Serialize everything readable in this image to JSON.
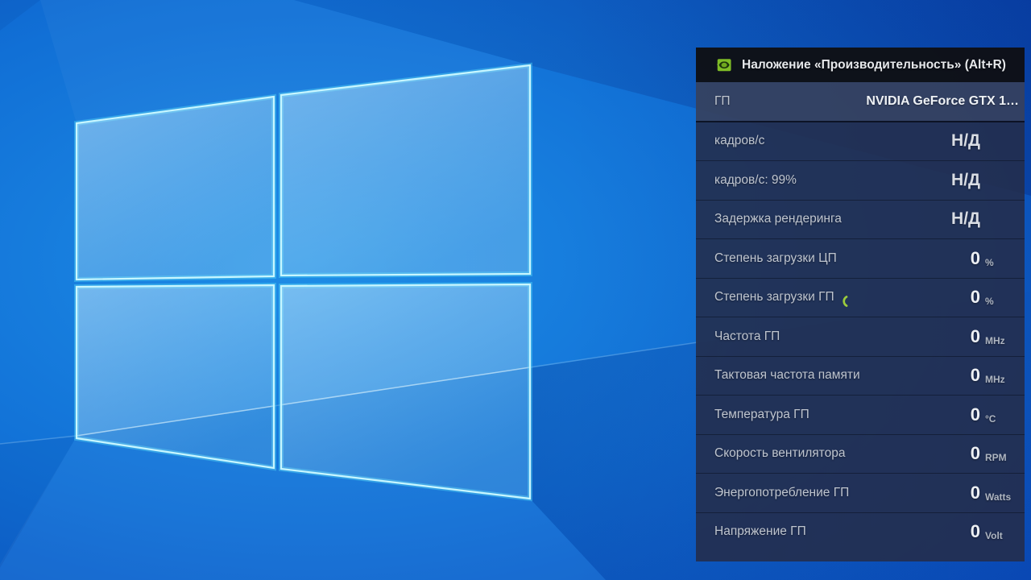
{
  "wallpaper": {
    "description": "windows-10-light-hero-wallpaper",
    "base_blue": "#1170d6",
    "pane_edge_color": "#c8f7ff"
  },
  "overlay": {
    "title": "Наложение «Производительность» (Alt+R)",
    "header_icon": "nvidia-geforce-logo",
    "accent_green": "#9ccc3c",
    "rows": [
      {
        "label": "ГП",
        "value": "NVIDIA GeForce GTX 1…",
        "unit": "",
        "highlight": true,
        "wide": true
      },
      {
        "label": "кадров/с",
        "value": "Н/Д",
        "unit": ""
      },
      {
        "label": "кадров/с: 99%",
        "value": "Н/Д",
        "unit": ""
      },
      {
        "label": "Задержка рендеринга",
        "value": "Н/Д",
        "unit": ""
      },
      {
        "label": "Степень загрузки ЦП",
        "value": "0",
        "unit": "%"
      },
      {
        "label": "Степень загрузки ГП",
        "value": "0",
        "unit": "%",
        "spinner": true
      },
      {
        "label": "Частота ГП",
        "value": "0",
        "unit": "MHz"
      },
      {
        "label": "Тактовая частота памяти",
        "value": "0",
        "unit": "MHz"
      },
      {
        "label": "Температура ГП",
        "value": "0",
        "unit": "°C"
      },
      {
        "label": "Скорость вентилятора",
        "value": "0",
        "unit": "RPM"
      },
      {
        "label": "Энергопотребление ГП",
        "value": "0",
        "unit": "Watts"
      },
      {
        "label": "Напряжение ГП",
        "value": "0",
        "unit": "Volt"
      }
    ]
  }
}
